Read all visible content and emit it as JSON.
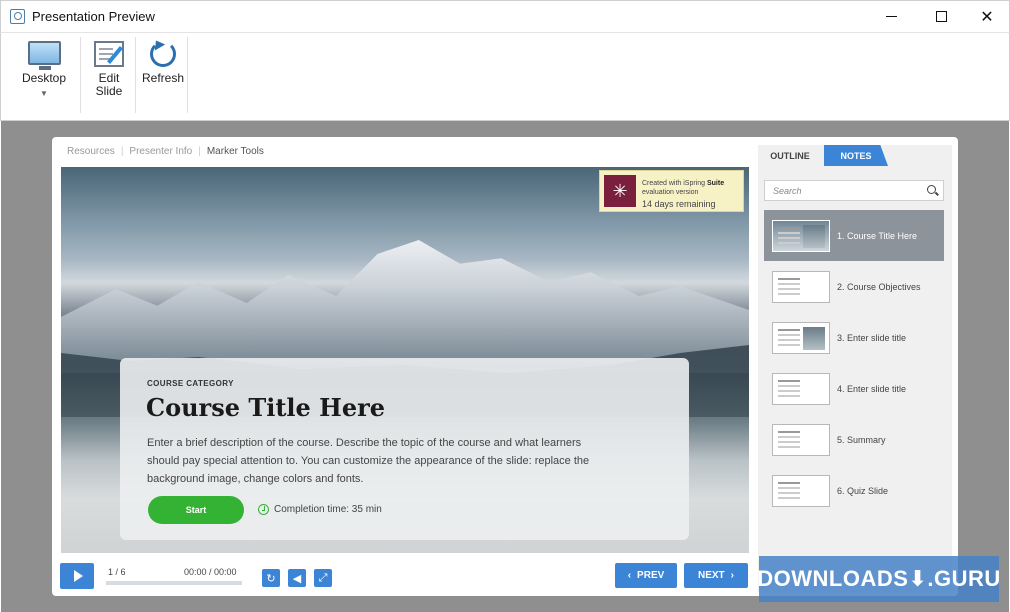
{
  "window": {
    "title": "Presentation Preview"
  },
  "ribbon": {
    "desktop_label": "Desktop",
    "edit_line1": "Edit",
    "edit_line2": "Slide",
    "refresh_label": "Refresh"
  },
  "player": {
    "tabs": [
      "Resources",
      "Presenter Info",
      "Marker Tools"
    ],
    "watermark": {
      "line1_pre": "Created with iSpring ",
      "line1_bold": "Suite",
      "line1_post": "evaluation version",
      "line2": "14 days remaining"
    },
    "slide": {
      "category": "COURSE CATEGORY",
      "title": "Course Title Here",
      "description": "Enter a brief description of the course. Describe the topic of the course and what learners should pay special attention to. You can customize the appearance of the slide: replace the background image, change colors and fonts.",
      "start_label": "Start",
      "completion": "Completion time: 35 min"
    },
    "controls": {
      "slide_counter": "1 / 6",
      "time": "00:00 / 00:00",
      "progress": 0.0,
      "prev_label": "PREV",
      "next_label": "NEXT"
    },
    "sidebar": {
      "tab_outline": "OUTLINE",
      "tab_notes": "NOTES",
      "search_placeholder": "Search",
      "items": [
        {
          "label": "1. Course Title Here",
          "selected": true
        },
        {
          "label": "2. Course Objectives",
          "selected": false
        },
        {
          "label": "3. Enter slide title",
          "selected": false
        },
        {
          "label": "4. Enter slide title",
          "selected": false
        },
        {
          "label": "5. Summary",
          "selected": false
        },
        {
          "label": "6. Quiz Slide",
          "selected": false
        }
      ]
    }
  },
  "badge": {
    "text": "DOWNLOADS⬇.GURU"
  },
  "colors": {
    "accent": "#3c84d6",
    "start": "#34b233",
    "watermark_logo": "#7a1f3e"
  }
}
